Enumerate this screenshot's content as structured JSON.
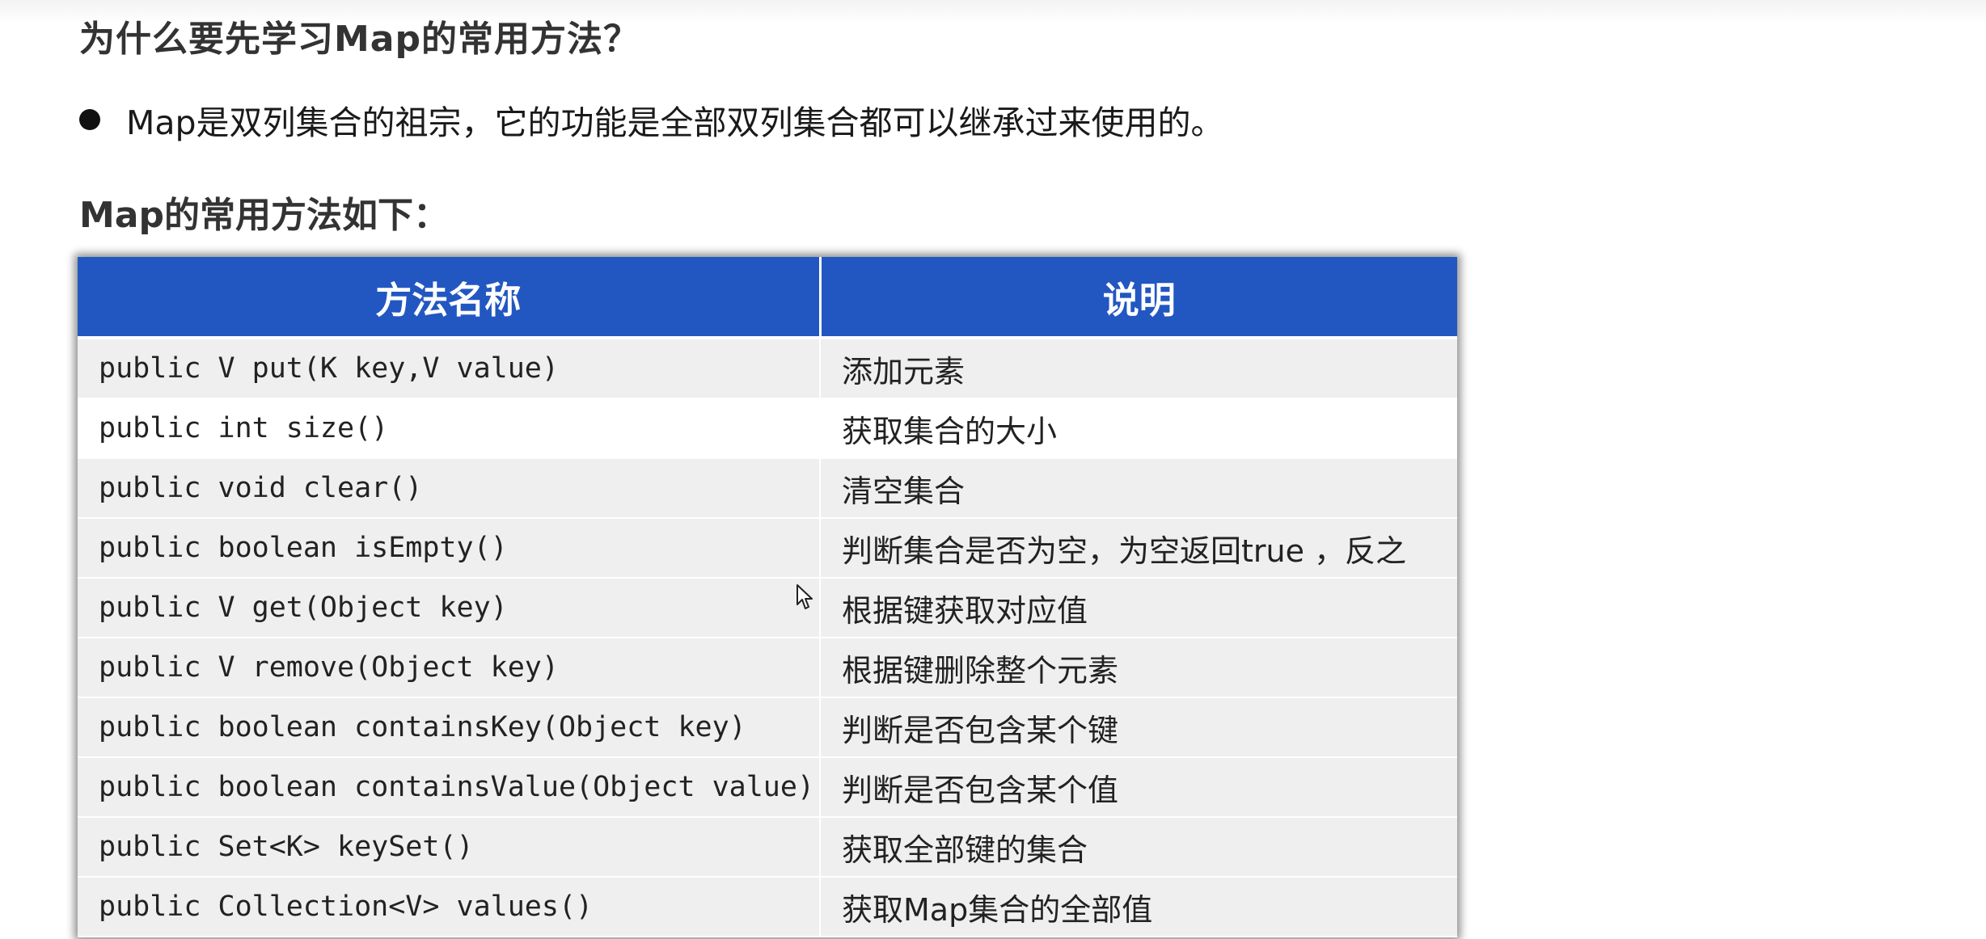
{
  "heading": "为什么要先学习Map的常用方法？",
  "bullet": "Map是双列集合的祖宗，它的功能是全部双列集合都可以继承过来使用的。",
  "subheading": "Map的常用方法如下：",
  "table": {
    "headers": [
      "方法名称",
      "说明"
    ],
    "rows": [
      {
        "method": "public V put(K key,V value)",
        "desc": "添加元素"
      },
      {
        "method": "public int size()",
        "desc": "获取集合的大小"
      },
      {
        "method": "public void clear()",
        "desc": "清空集合"
      },
      {
        "method": "public boolean isEmpty()",
        "desc": "判断集合是否为空，为空返回true ，反之"
      },
      {
        "method": "public V get(Object key)",
        "desc": "根据键获取对应值"
      },
      {
        "method": "public V remove(Object key)",
        "desc": "根据键删除整个元素"
      },
      {
        "method": "public  boolean containsKey(Object key)",
        "desc": "判断是否包含某个键"
      },
      {
        "method": "public boolean containsValue(Object value)",
        "desc": "判断是否包含某个值"
      },
      {
        "method": "public Set<K> keySet()",
        "desc": "获取全部键的集合"
      },
      {
        "method": "public Collection<V> values()",
        "desc": "获取Map集合的全部值"
      }
    ]
  }
}
